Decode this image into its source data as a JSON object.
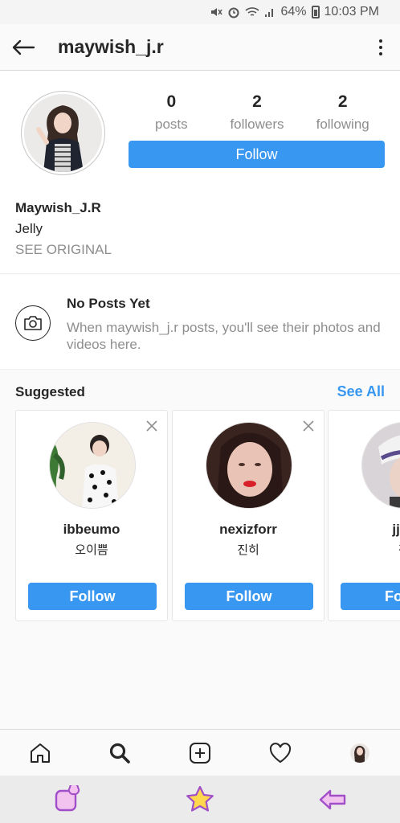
{
  "status_bar": {
    "battery": "64%",
    "time": "10:03 PM"
  },
  "header": {
    "username": "maywish_j.r"
  },
  "profile": {
    "stats": [
      {
        "value": "0",
        "label": "posts"
      },
      {
        "value": "2",
        "label": "followers"
      },
      {
        "value": "2",
        "label": "following"
      }
    ],
    "follow_label": "Follow",
    "display_name": "Maywish_J.R",
    "bio": "Jelly",
    "see_original": "SEE ORIGINAL"
  },
  "no_posts": {
    "title": "No Posts Yet",
    "text": "When maywish_j.r posts, you'll see their photos and videos here."
  },
  "suggested": {
    "title": "Suggested",
    "see_all": "See All",
    "cards": [
      {
        "username": "ibbeumo",
        "subtitle": "오이쁨",
        "follow_label": "Follow"
      },
      {
        "username": "nexizforr",
        "subtitle": "진히",
        "follow_label": "Follow"
      },
      {
        "username": "jjin.",
        "subtitle": "찐",
        "follow_label": "Fo"
      }
    ]
  },
  "colors": {
    "accent": "#3897f0",
    "nav_icon": "#a04fc9",
    "nav_fill": "#f3c3ef",
    "star_fill": "#ffd84d"
  },
  "tab_bar": {
    "icons": [
      "home-icon",
      "search-icon",
      "add-post-icon",
      "heart-icon",
      "profile-avatar"
    ],
    "active": "search-icon"
  },
  "nav_bar": {
    "icons": [
      "recents-icon",
      "home-star-icon",
      "back-arrow-icon"
    ]
  }
}
